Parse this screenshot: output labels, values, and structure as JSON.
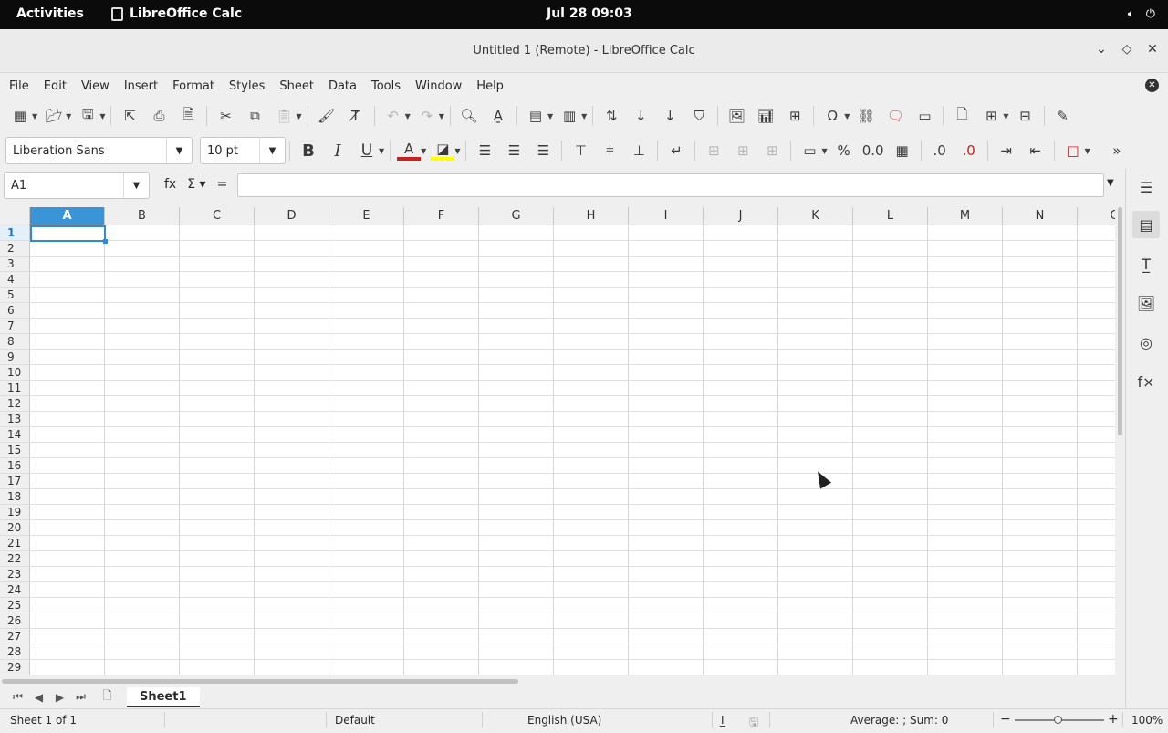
{
  "topbar": {
    "activities": "Activities",
    "app_name": "LibreOffice Calc",
    "clock": "Jul 28  09:03",
    "tray": [
      "speaker-icon",
      "power-icon"
    ]
  },
  "window": {
    "title": "Untitled 1 (Remote) - LibreOffice Calc",
    "buttons": [
      "minimize-icon",
      "restore-icon",
      "close-icon"
    ]
  },
  "menubar": [
    "File",
    "Edit",
    "View",
    "Insert",
    "Format",
    "Styles",
    "Sheet",
    "Data",
    "Tools",
    "Window",
    "Help"
  ],
  "formatting": {
    "font_name": "Liberation Sans",
    "font_size": "10 pt"
  },
  "formula_bar": {
    "name_box": "A1",
    "function_wizard": "fx",
    "sum": "Σ",
    "equals": "=",
    "content": ""
  },
  "grid": {
    "columns": [
      "A",
      "B",
      "C",
      "D",
      "E",
      "F",
      "G",
      "H",
      "I",
      "J",
      "K",
      "L",
      "M",
      "N",
      "O"
    ],
    "rows": [
      "1",
      "2",
      "3",
      "4",
      "5",
      "6",
      "7",
      "8",
      "9",
      "10",
      "11",
      "12",
      "13",
      "14",
      "15",
      "16",
      "17",
      "18",
      "19",
      "20",
      "21",
      "22",
      "23",
      "24",
      "25",
      "26",
      "27",
      "28",
      "29"
    ],
    "selected_cell": "A1"
  },
  "sheet_tabs": {
    "tabs": [
      "Sheet1"
    ],
    "active": "Sheet1"
  },
  "statusbar": {
    "sheet": "Sheet 1 of 1",
    "page_style": "Default",
    "language": "English (USA)",
    "selection_mode": "I̲",
    "summary": "Average: ; Sum: 0",
    "zoom_minus": "−",
    "zoom_plus": "+",
    "zoom": "100%"
  },
  "colors": {
    "selection": "#3a95d8",
    "font_color": "#c9211e",
    "highlight": "#ffff00"
  }
}
